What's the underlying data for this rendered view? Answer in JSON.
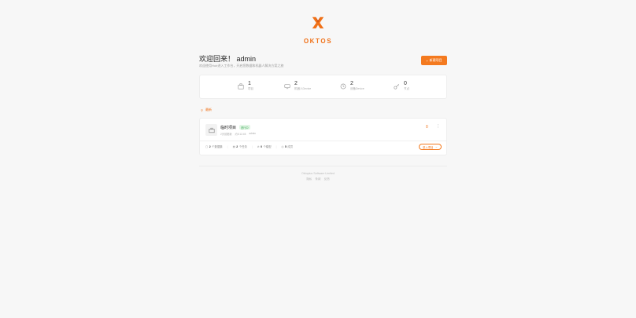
{
  "brand": {
    "name": "OKTOS",
    "accent": "#f07118"
  },
  "welcome": {
    "title": "欢迎回来！ admin",
    "subtitle": "欢迎使用Hub进入工作台，开启您数据和机器人解决方案之旅"
  },
  "new_project_button": {
    "label": "新建项目",
    "icon": "plus-icon"
  },
  "stats": [
    {
      "value": "1",
      "label": "项目",
      "icon": "building-icon"
    },
    {
      "value": "2",
      "label": "机器人Device",
      "icon": "monitor-icon"
    },
    {
      "value": "2",
      "label": "设备Device",
      "icon": "clock-icon"
    },
    {
      "value": "0",
      "label": "节点",
      "icon": "key-icon"
    }
  ],
  "section": {
    "label": "最新",
    "icon": "pin-icon"
  },
  "project": {
    "name": "临时项目",
    "badge": "进行中",
    "meta": [
      "2天前更新",
      "约5.12.45",
      "admin"
    ],
    "star_count": "0",
    "stats": [
      {
        "value": "2",
        "label": "个数据集",
        "icon": "database-icon"
      },
      {
        "value": "2",
        "label": "个任务",
        "icon": "list-icon"
      },
      {
        "value": "0",
        "label": "个模型",
        "icon": "link-icon"
      },
      {
        "value": "5",
        "label": "成员",
        "icon": "user-icon"
      }
    ],
    "enter_label": "进入项目"
  },
  "footer": {
    "copyright": "Oktoplus Software Limited",
    "links": [
      "隐私",
      "条款",
      "反馈"
    ]
  }
}
